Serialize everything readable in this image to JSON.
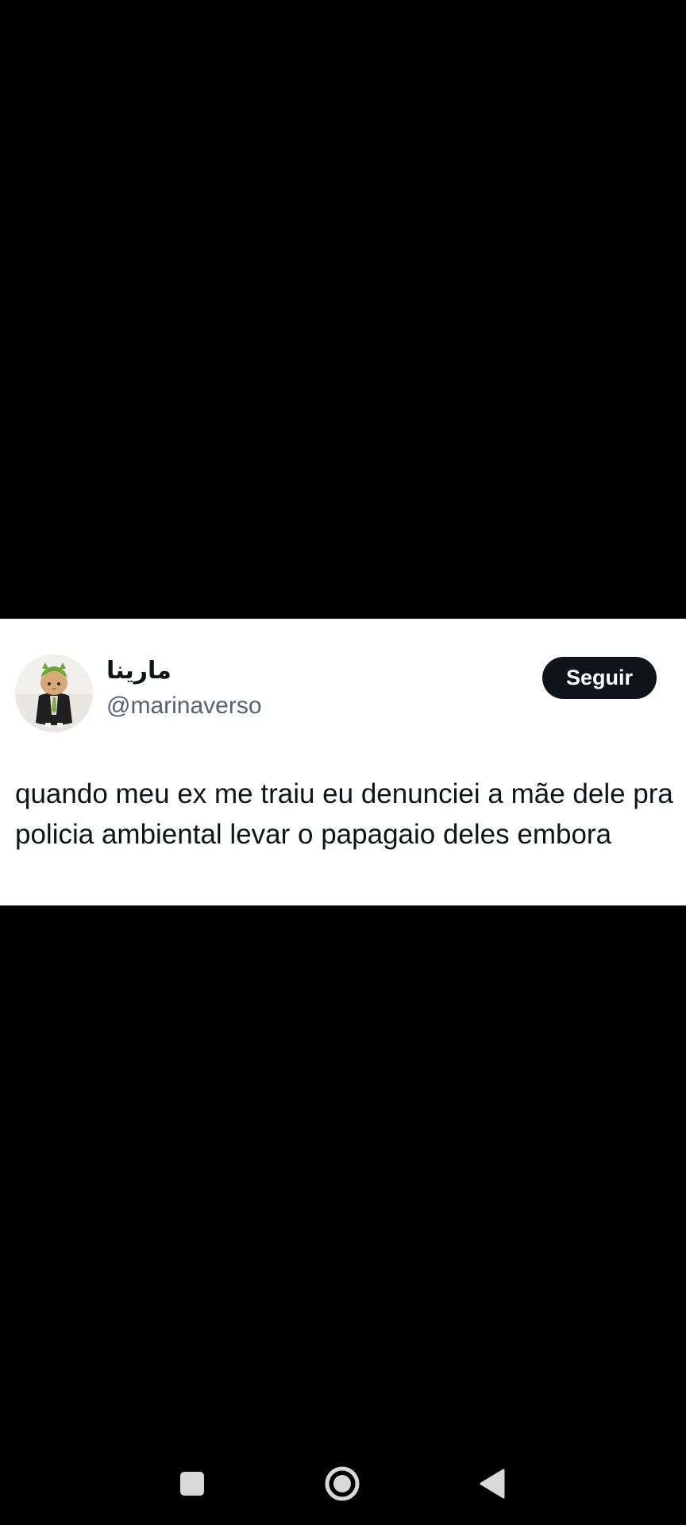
{
  "tweet": {
    "display_name": "مارينا",
    "handle": "@marinaverso",
    "follow_label": "Seguir",
    "text": "quando meu ex me traiu eu denunciei a mãe dele pra policia ambiental levar o papagaio deles embora",
    "avatar_icon": "cat-avatar-icon"
  },
  "colors": {
    "background": "#000000",
    "card": "#ffffff",
    "text_primary": "#0f1419",
    "text_secondary": "#536471",
    "button_bg": "#0f1419",
    "button_text": "#ffffff",
    "nav_icons": "#d9d9d9"
  },
  "navigation": {
    "recents_icon": "square-recents-icon",
    "home_icon": "circle-home-icon",
    "back_icon": "triangle-back-icon"
  }
}
